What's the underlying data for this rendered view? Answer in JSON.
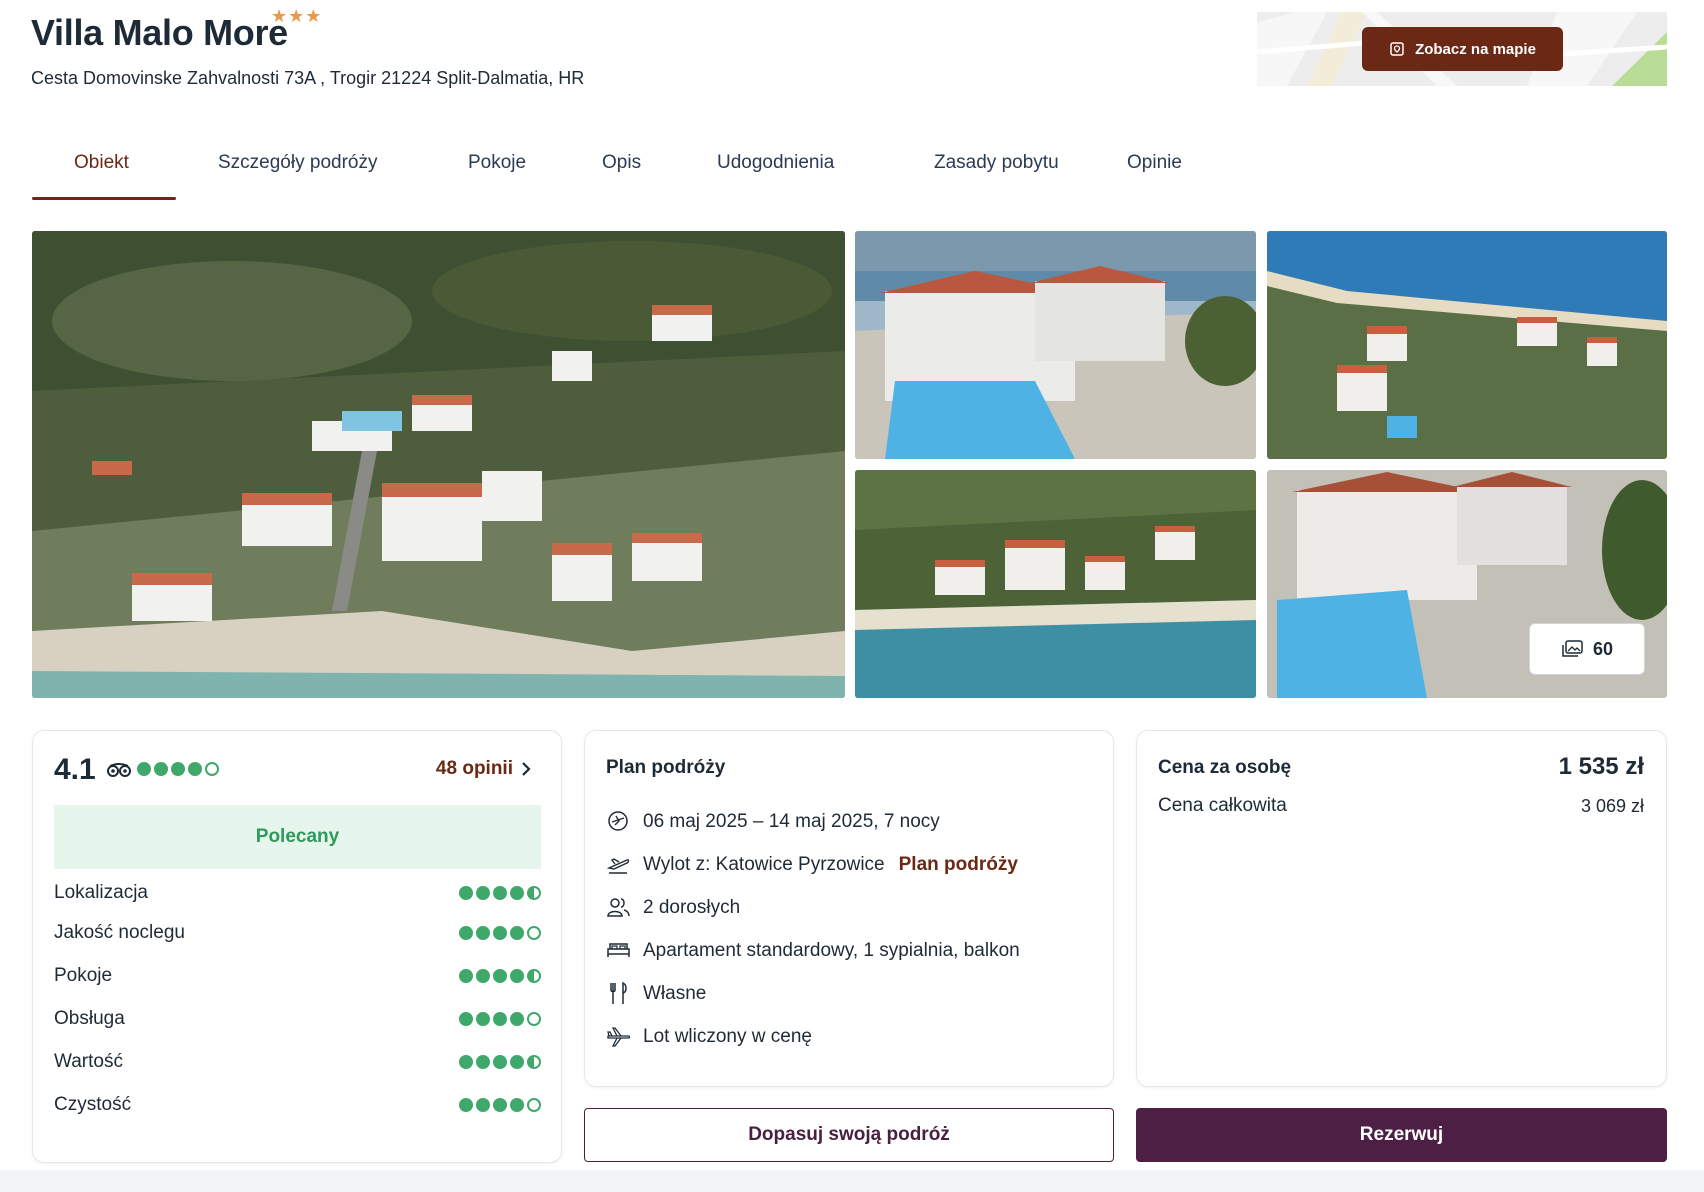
{
  "header": {
    "title": "Villa Malo More",
    "stars": "★★★",
    "address": "Cesta Domovinske Zahvalnosti 73A , Trogir 21224 Split-Dalmatia, HR",
    "map_button": "Zobacz na mapie"
  },
  "tabs": [
    {
      "label": "Obiekt",
      "active": true
    },
    {
      "label": "Szczegóły podróży"
    },
    {
      "label": "Pokoje"
    },
    {
      "label": "Opis"
    },
    {
      "label": "Udogodnienia"
    },
    {
      "label": "Zasady pobytu"
    },
    {
      "label": "Opinie"
    }
  ],
  "gallery": {
    "photo_count": "60"
  },
  "rating": {
    "score": "4.1",
    "score_dots": 4,
    "reviews_link": "48 opinii",
    "badge": "Polecany",
    "categories": [
      {
        "label": "Lokalizacja",
        "dots": 4.5
      },
      {
        "label": "Jakość noclegu",
        "dots": 4
      },
      {
        "label": "Pokoje",
        "dots": 4.5
      },
      {
        "label": "Obsługa",
        "dots": 4
      },
      {
        "label": "Wartość",
        "dots": 4.5
      },
      {
        "label": "Czystość",
        "dots": 4
      }
    ]
  },
  "plan": {
    "title": "Plan podróży",
    "dates": "06 maj 2025 – 14 maj 2025, 7 nocy",
    "departure": "Wylot z: Katowice Pyrzowice",
    "departure_link": "Plan podróży",
    "guests": "2 dorosłych",
    "room": "Apartament standardowy, 1 sypialnia, balkon",
    "board": "Własne",
    "flight": "Lot wliczony w cenę"
  },
  "price": {
    "per_person_label": "Cena za osobę",
    "per_person_value": "1 535 zł",
    "total_label": "Cena całkowita",
    "total_value": "3 069 zł"
  },
  "actions": {
    "customize": "Dopasuj swoją podróż",
    "book": "Rezerwuj"
  },
  "colors": {
    "brand": "#6b2814",
    "primary_button": "#4d1f45",
    "rating_green": "#3fa86a",
    "badge_bg": "#e6f6ed",
    "star": "#e8994a"
  }
}
